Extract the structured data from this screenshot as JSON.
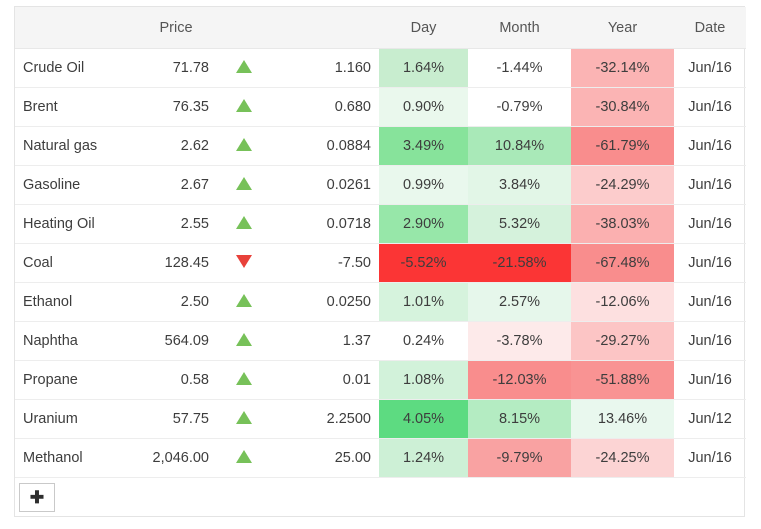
{
  "table": {
    "columns": [
      {
        "key": "name",
        "label": ""
      },
      {
        "key": "price",
        "label": "Price"
      },
      {
        "key": "arrow",
        "label": ""
      },
      {
        "key": "chg",
        "label": ""
      },
      {
        "key": "day",
        "label": "Day"
      },
      {
        "key": "month",
        "label": "Month"
      },
      {
        "key": "year",
        "label": "Year"
      },
      {
        "key": "date",
        "label": "Date"
      }
    ],
    "rows": [
      {
        "name": "Crude Oil",
        "price": "71.78",
        "direction": "up",
        "change": "1.160",
        "day": "1.64%",
        "day_bg": "#c8edcf",
        "month": "-1.44%",
        "month_bg": "#ffffff",
        "year": "-32.14%",
        "year_bg": "#fbb4b4",
        "date": "Jun/16"
      },
      {
        "name": "Brent",
        "price": "76.35",
        "direction": "up",
        "change": "0.680",
        "day": "0.90%",
        "day_bg": "#eaf8ed",
        "month": "-0.79%",
        "month_bg": "#ffffff",
        "year": "-30.84%",
        "year_bg": "#fbb4b4",
        "date": "Jun/16"
      },
      {
        "name": "Natural gas",
        "price": "2.62",
        "direction": "up",
        "change": "0.0884",
        "day": "3.49%",
        "day_bg": "#87e39b",
        "month": "10.84%",
        "month_bg": "#a9e9b8",
        "year": "-61.79%",
        "year_bg": "#f98d8d",
        "date": "Jun/16"
      },
      {
        "name": "Gasoline",
        "price": "2.67",
        "direction": "up",
        "change": "0.0261",
        "day": "0.99%",
        "day_bg": "#e9f8ed",
        "month": "3.84%",
        "month_bg": "#e2f6e7",
        "year": "-24.29%",
        "year_bg": "#fccccc",
        "date": "Jun/16"
      },
      {
        "name": "Heating Oil",
        "price": "2.55",
        "direction": "up",
        "change": "0.0718",
        "day": "2.90%",
        "day_bg": "#97e7a9",
        "month": "5.32%",
        "month_bg": "#d5f2dc",
        "year": "-38.03%",
        "year_bg": "#fbb0b0",
        "date": "Jun/16"
      },
      {
        "name": "Coal",
        "price": "128.45",
        "direction": "down",
        "change": "-7.50",
        "day": "-5.52%",
        "day_bg": "#fb3535",
        "month": "-21.58%",
        "month_bg": "#fb3535",
        "year": "-67.48%",
        "year_bg": "#f98d8d",
        "date": "Jun/16"
      },
      {
        "name": "Ethanol",
        "price": "2.50",
        "direction": "up",
        "change": "0.0250",
        "day": "1.01%",
        "day_bg": "#d6f3dd",
        "month": "2.57%",
        "month_bg": "#e6f7eb",
        "year": "-12.06%",
        "year_bg": "#fde0e0",
        "date": "Jun/16"
      },
      {
        "name": "Naphtha",
        "price": "564.09",
        "direction": "up",
        "change": "1.37",
        "day": "0.24%",
        "day_bg": "#ffffff",
        "month": "-3.78%",
        "month_bg": "#fdeaea",
        "year": "-29.27%",
        "year_bg": "#fcc5c5",
        "date": "Jun/16"
      },
      {
        "name": "Propane",
        "price": "0.58",
        "direction": "up",
        "change": "0.01",
        "day": "1.08%",
        "day_bg": "#d2f2da",
        "month": "-12.03%",
        "month_bg": "#f98d8d",
        "year": "-51.88%",
        "year_bg": "#f99393",
        "date": "Jun/16"
      },
      {
        "name": "Uranium",
        "price": "57.75",
        "direction": "up",
        "change": "2.2500",
        "day": "4.05%",
        "day_bg": "#5ddb81",
        "month": "8.15%",
        "month_bg": "#b4ecc2",
        "year": "13.46%",
        "year_bg": "#e9f8ee",
        "date": "Jun/12"
      },
      {
        "name": "Methanol",
        "price": "2,046.00",
        "direction": "up",
        "change": "25.00",
        "day": "1.24%",
        "day_bg": "#cdf0d6",
        "month": "-9.79%",
        "month_bg": "#f9a2a2",
        "year": "-24.25%",
        "year_bg": "#fcd4d4",
        "date": "Jun/16"
      }
    ],
    "add_button_label": "✚"
  },
  "colors": {
    "up_arrow": "#77c159",
    "down_arrow": "#e8413a",
    "header_bg": "#f5f5f5",
    "border": "#e4e4e4"
  }
}
